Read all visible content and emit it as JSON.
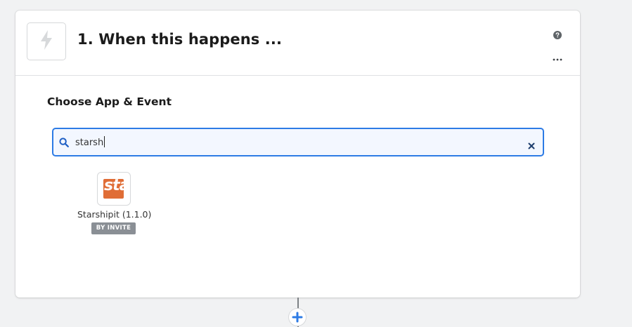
{
  "step": {
    "title": "1. When this happens ...",
    "trigger_icon": "lightning-bolt-icon",
    "help_icon": "question-circle-icon",
    "more_icon": "ellipsis-icon"
  },
  "choose_app": {
    "section_title": "Choose App & Event",
    "search": {
      "value": "starsh",
      "search_icon": "magnifier-icon",
      "clear_icon": "close-x-icon"
    },
    "results": [
      {
        "name": "Starshipit (1.1.0)",
        "badge": "BY INVITE",
        "logo_text": "sta",
        "logo_color": "#e06d36"
      }
    ]
  },
  "connector": {
    "add_icon": "plus-icon",
    "accent": "#2d7be5"
  }
}
